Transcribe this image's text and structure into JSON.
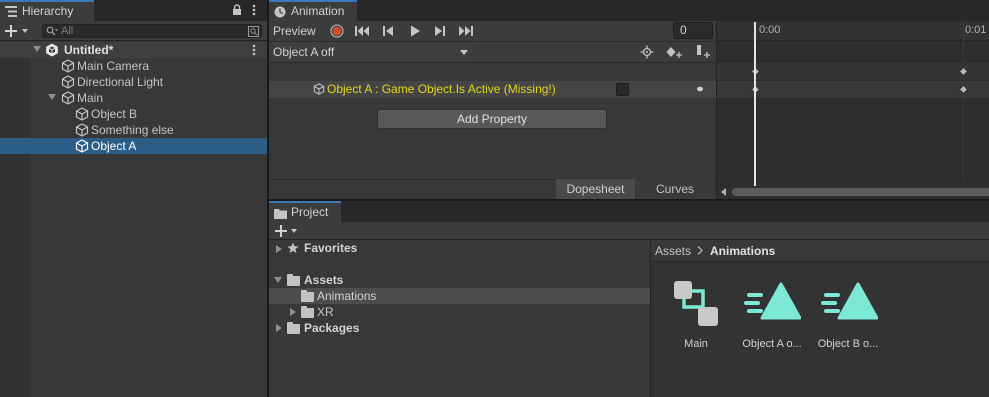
{
  "hierarchy": {
    "tab_label": "Hierarchy",
    "search_placeholder": "All",
    "scene_name": "Untitled*",
    "items": [
      {
        "label": "Main Camera"
      },
      {
        "label": "Directional Light"
      },
      {
        "label": "Main"
      },
      {
        "label": "Object B"
      },
      {
        "label": "Something else"
      },
      {
        "label": "Object A"
      }
    ]
  },
  "animation": {
    "tab_label": "Animation",
    "preview_label": "Preview",
    "frame_value": "0",
    "clip_name": "Object A off",
    "property_label": "Object A : Game Object.Is Active (Missing!)",
    "add_property_label": "Add Property",
    "dopesheet_label": "Dopesheet",
    "curves_label": "Curves",
    "time_start": "0:00",
    "time_next": "0:01"
  },
  "project": {
    "tab_label": "Project",
    "tree": {
      "favorites": "Favorites",
      "assets": "Assets",
      "animations": "Animations",
      "xr": "XR",
      "packages": "Packages"
    },
    "breadcrumb": {
      "root": "Assets",
      "current": "Animations"
    },
    "assets": [
      {
        "label": "Main",
        "icon": "animator-controller-icon"
      },
      {
        "label": "Object A o...",
        "icon": "animation-clip-icon"
      },
      {
        "label": "Object B o...",
        "icon": "animation-clip-icon"
      }
    ]
  },
  "colors": {
    "selection": "#2c5d87",
    "missing_text": "#e3d71a",
    "asset_teal": "#7ee8d7",
    "record_red": "#d24b33"
  }
}
